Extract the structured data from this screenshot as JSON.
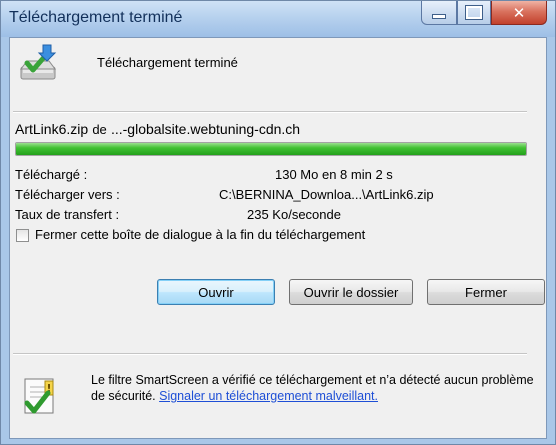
{
  "window": {
    "title": "Téléchargement terminé"
  },
  "header": {
    "text": "Téléchargement terminé",
    "icon": "download-complete-icon"
  },
  "download": {
    "filename": "ArtLink6.zip",
    "from_word": "de",
    "source": "...-globalsite.webtuning-cdn.ch",
    "progress_percent": 100,
    "rows": [
      {
        "label": "Téléchargé :",
        "value": "130 Mo en 8 min 2 s"
      },
      {
        "label": "Télécharger vers :",
        "value": "C:\\BERNINA_Downloa...\\ArtLink6.zip"
      },
      {
        "label": "Taux de transfert :",
        "value": "235 Ko/seconde"
      }
    ]
  },
  "checkbox": {
    "label": "Fermer cette boîte de dialogue à la fin du téléchargement",
    "checked": false
  },
  "buttons": {
    "open": "Ouvrir",
    "open_folder": "Ouvrir le dossier",
    "close": "Fermer"
  },
  "footer": {
    "text": "Le filtre SmartScreen a vérifié ce téléchargement et n’a détecté aucun problème de sécurité.",
    "link": "Signaler un téléchargement malveillant."
  },
  "colors": {
    "progress": "#2fb324",
    "link": "#1e4fd6",
    "titlebar": "#b7d1ee",
    "close_button": "#c2412c"
  }
}
